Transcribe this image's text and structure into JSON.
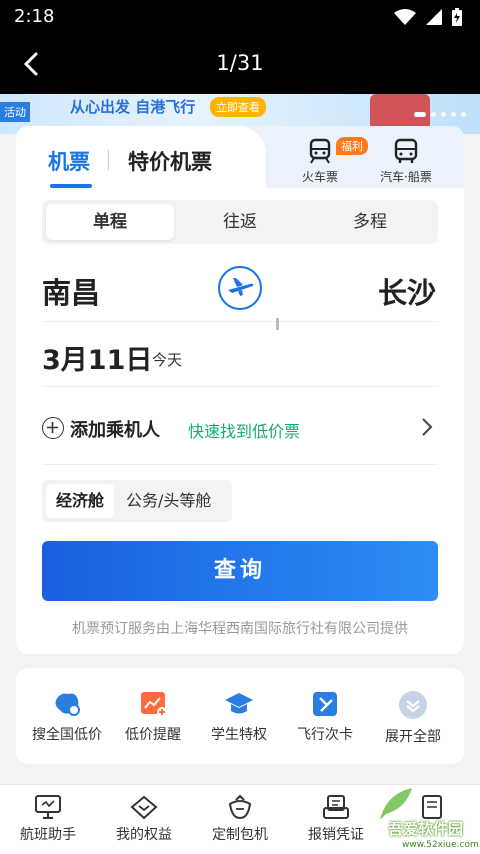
{
  "status_bar": {
    "time": "2:18"
  },
  "viewer": {
    "counter": "1/31"
  },
  "banner": {
    "tag": "活动",
    "slogan": "从心出发 自港飞行",
    "cta": "立即查看"
  },
  "tabs": {
    "flight": "机票",
    "special": "特价机票",
    "badge": "福利",
    "train": "火车票",
    "bus": "汽车·船票"
  },
  "trip_types": [
    "单程",
    "往返",
    "多程"
  ],
  "route": {
    "from": "南昌",
    "to": "长沙"
  },
  "date": {
    "value": "3月11日",
    "sub": "今天"
  },
  "passenger": {
    "add_label": "添加乘机人",
    "hint": "快速找到低价票"
  },
  "cabin": {
    "economy": "经济舱",
    "business": "公务/头等舱"
  },
  "search_button": "查询",
  "provider_note": "机票预订服务由上海华程西南国际旅行社有限公司提供",
  "quick_links": [
    "搜全国低价",
    "低价提醒",
    "学生特权",
    "飞行次卡",
    "展开全部"
  ],
  "bottom_nav": [
    "航班助手",
    "我的权益",
    "定制包机",
    "报销凭证"
  ],
  "watermark": {
    "name": "吾爱软件园",
    "url": "www.52xiue.com"
  },
  "colors": {
    "accent": "#1a73e8",
    "hint_green": "#19a974",
    "badge_orange": "#ff7a1a"
  }
}
